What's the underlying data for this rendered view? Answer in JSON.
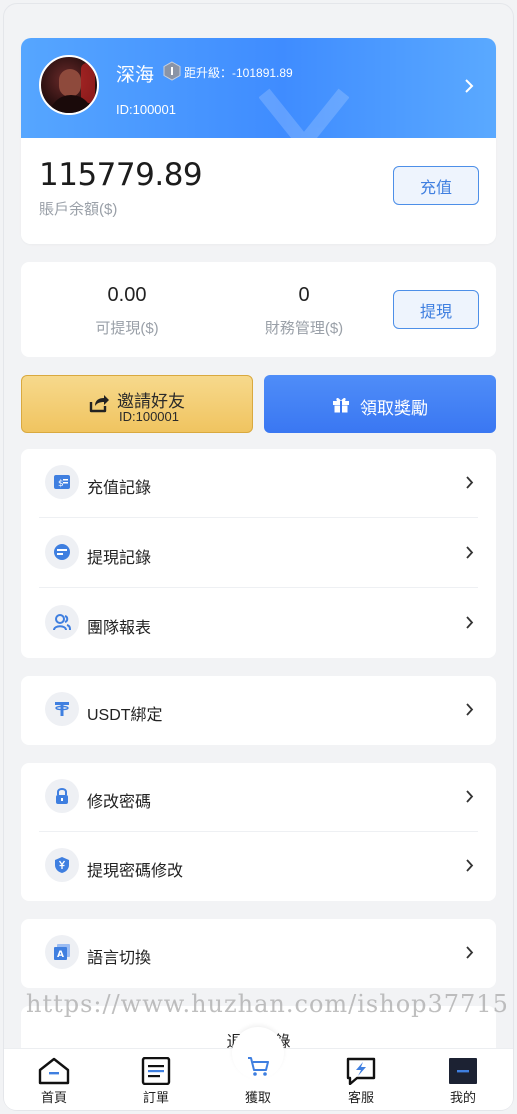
{
  "profile": {
    "username": "深海",
    "upgrade_text": "距升級：-101891.89",
    "user_id": "ID:100001",
    "balance": "115779.89",
    "balance_label": "賬戶余額($)",
    "recharge_label": "充值"
  },
  "stats": {
    "withdrawable_value": "0.00",
    "withdrawable_label": "可提現($)",
    "finance_value": "0",
    "finance_label": "財務管理($)",
    "withdraw_label": "提現"
  },
  "actions": {
    "invite_label": "邀請好友",
    "invite_id": "ID:100001",
    "reward_label": "領取獎勵"
  },
  "menus": {
    "recharge_records": "充值記錄",
    "withdraw_records": "提現記錄",
    "team_report": "團隊報表",
    "usdt_binding": "USDT綁定",
    "change_password": "修改密碼",
    "change_withdraw_password": "提現密碼修改",
    "language_switch": "語言切換",
    "logout": "退出登錄"
  },
  "watermark": "https://www.huzhan.com/ishop37715",
  "tabbar": {
    "home": "首頁",
    "orders": "訂單",
    "grab": "獲取",
    "service": "客服",
    "mine": "我的"
  },
  "colors": {
    "accent": "#3f8cff",
    "gold": "#f0c460",
    "reward_blue": "#3a77f2",
    "page_bg": "#f2f3f5"
  }
}
